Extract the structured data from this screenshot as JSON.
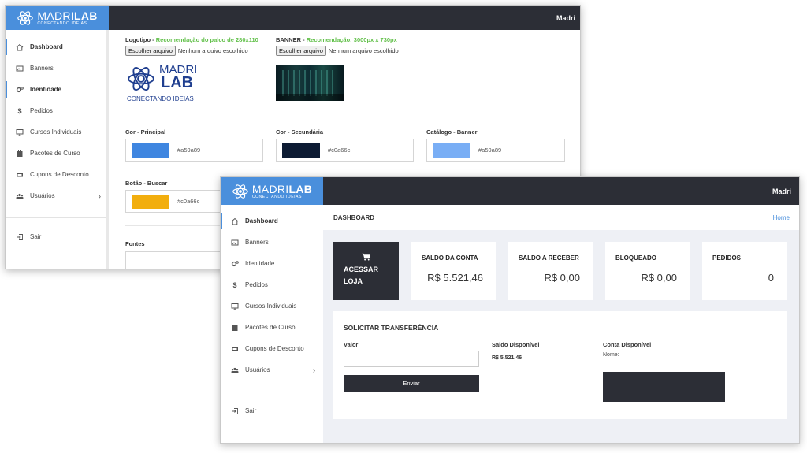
{
  "brand": {
    "name_light": "MADRI",
    "name_bold": "LAB",
    "tagline": "CONECTANDO IDEIAS"
  },
  "user": {
    "name": "Madri"
  },
  "sidebar": {
    "items": [
      {
        "label": "Dashboard",
        "icon": "home-icon"
      },
      {
        "label": "Banners",
        "icon": "image-icon"
      },
      {
        "label": "Identidade",
        "icon": "gears-icon"
      },
      {
        "label": "Pedidos",
        "icon": "dollar-icon"
      },
      {
        "label": "Cursos Individuais",
        "icon": "monitor-icon"
      },
      {
        "label": "Pacotes de Curso",
        "icon": "calendar-icon"
      },
      {
        "label": "Cupons de Desconto",
        "icon": "ticket-icon"
      },
      {
        "label": "Usuários",
        "icon": "users-icon"
      }
    ],
    "logout": "Sair"
  },
  "identity": {
    "logo_label": "Logotipo - ",
    "logo_rec": "Recomendação do palco de 280x110",
    "banner_label": "BANNER - ",
    "banner_rec": "Recomendação: 3000px x 730px",
    "file_button": "Escolher arquivo",
    "file_status": "Nenhum arquivo escolhido",
    "colors": [
      {
        "label": "Cor - Principal",
        "value": "#a59a89",
        "swatch": "#3f86e0"
      },
      {
        "label": "Cor - Secundária",
        "value": "#c0a66c",
        "swatch": "#0d1b33"
      },
      {
        "label": "Catálogo - Banner",
        "value": "#a59a89",
        "swatch": "#79aef5"
      },
      {
        "label": "Botão - Buscar",
        "value": "#c0a66c",
        "swatch": "#f2ae0e"
      }
    ],
    "fonts_label": "Fontes"
  },
  "dashboard": {
    "title": "DASHBOARD",
    "breadcrumb": "Home",
    "store_button_line1": "ACESSAR",
    "store_button_line2": "LOJA",
    "cards": [
      {
        "title": "SALDO DA CONTA",
        "value": "R$ 5.521,46"
      },
      {
        "title": "SALDO A RECEBER",
        "value": "R$ 0,00"
      },
      {
        "title": "BLOQUEADO",
        "value": "R$ 0,00"
      },
      {
        "title": "PEDIDOS",
        "value": "0"
      }
    ],
    "transfer": {
      "title": "SOLICITAR TRANSFERÊNCIA",
      "value_label": "Valor",
      "value_input": "",
      "submit_label": "Enviar",
      "available_label": "Saldo Disponível",
      "available_value": "R$ 5.521,46",
      "account_label": "Conta Disponível",
      "account_name_label": "Nome:"
    }
  },
  "colors": {
    "accent": "#4a8fdc",
    "dark": "#2c2e36",
    "background": "#eef0f5"
  }
}
